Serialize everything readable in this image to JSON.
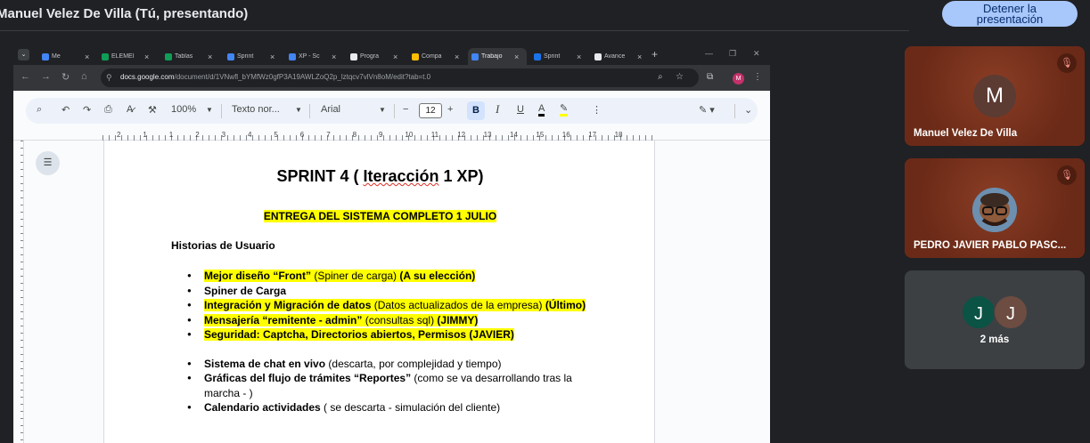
{
  "meet": {
    "presenter_title": "Manuel Velez De Villa (Tú, presentando)",
    "stop_button_line1": "Detener la",
    "stop_button_line2": "presentación"
  },
  "browser": {
    "tabs": [
      {
        "label": "Me",
        "color": "#4285f4"
      },
      {
        "label": "ELEMEI",
        "color": "#0f9d58"
      },
      {
        "label": "Tablas",
        "color": "#0f9d58"
      },
      {
        "label": "Sprint",
        "color": "#4285f4"
      },
      {
        "label": "XP - Sc",
        "color": "#4285f4"
      },
      {
        "label": "Progra",
        "color": "#e8eaed"
      },
      {
        "label": "Compa",
        "color": "#fbbc04"
      },
      {
        "label": "Trabajo",
        "color": "#4285f4"
      },
      {
        "label": "Sprint",
        "color": "#1a73e8"
      },
      {
        "label": "Avance",
        "color": "#e8eaed"
      }
    ],
    "url_domain": "docs.google.com",
    "url_path": "/document/d/1VNwfl_bYMfWz0gfP3A19AWLZoQ2p_lztqcv7vlVn8oM/edit?tab=t.0"
  },
  "toolbar": {
    "zoom": "100%",
    "style": "Texto nor...",
    "font": "Arial",
    "font_size": "12",
    "bold": "B",
    "italic": "I",
    "underline": "U",
    "text_color": "A"
  },
  "ruler": {
    "numbers": [
      "2",
      "1",
      "1",
      "2",
      "3",
      "4",
      "5",
      "6",
      "7",
      "8",
      "9",
      "10",
      "11",
      "12",
      "13",
      "14",
      "15",
      "16",
      "17",
      "18"
    ]
  },
  "document": {
    "title_before": "SPRINT 4 ( ",
    "title_squiggle": "Iteracción",
    "title_after": " 1 XP)",
    "subtitle": "ENTREGA DEL SISTEMA COMPLETO 1 JULIO",
    "section_heading": "Historias de Usuario",
    "bullets": [
      {
        "bold": "Mejor diseño “Front”",
        "normal": " (Spiner de carga) ",
        "bold2": "(A su elección)",
        "highlight": true
      },
      {
        "bold": "Spiner de Carga",
        "normal": "",
        "bold2": "",
        "highlight": false
      },
      {
        "bold": "Integración y Migración de datos",
        "normal": " (Datos actualizados de la empresa) ",
        "bold2": "(Último)",
        "highlight": true
      },
      {
        "bold": "Mensajería “remitente - admin”",
        "normal": " (consultas sql) ",
        "bold2": "(JIMMY)",
        "highlight": true
      },
      {
        "bold": "Seguridad: Captcha, Directorios abiertos, Permisos (JAVIER)",
        "normal": "",
        "bold2": "",
        "highlight": true
      }
    ],
    "bullets2": [
      {
        "bold": "Sistema de chat en vivo",
        "normal": " (descarta, por complejidad y tiempo)"
      },
      {
        "bold": "Gráficas del flujo de trámites “Reportes”",
        "normal": " (como se va desarrollando tras la marcha - )"
      },
      {
        "bold": "Calendario actividades",
        "normal": " ( se descarta - simulación del cliente)"
      }
    ]
  },
  "participants": [
    {
      "name": "Manuel Velez De Villa",
      "initial": "M",
      "muted": true
    },
    {
      "name": "PEDRO JAVIER PABLO PASC...",
      "muted": true
    },
    {
      "more_label": "2 más",
      "initials": [
        "J",
        "J"
      ],
      "colors": [
        "#0b5345",
        "#6d4c41"
      ]
    }
  ]
}
